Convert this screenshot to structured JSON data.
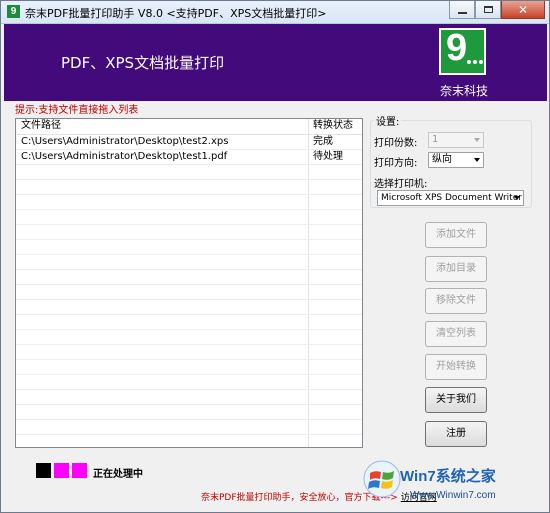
{
  "window": {
    "title": "奈末PDF批量打印助手 V8.0   <支持PDF、XPS文档批量打印>",
    "icon_glyph": "9"
  },
  "banner": {
    "title": "PDF、XPS文档批量打印",
    "brand_name": "奈末科技",
    "logo_glyph": "9"
  },
  "hint": "提示:支持文件直接拖入列表",
  "file_list": {
    "columns": [
      "文件路径",
      "转换状态"
    ],
    "rows": [
      {
        "path": "C:\\Users\\Administrator\\Desktop\\test2.xps",
        "status": "完成"
      },
      {
        "path": "C:\\Users\\Administrator\\Desktop\\test1.pdf",
        "status": "待处理"
      }
    ]
  },
  "settings": {
    "legend": "设置:",
    "copies_label": "打印份数:",
    "copies_value": "1",
    "orientation_label": "打印方向:",
    "orientation_value": "纵向",
    "printer_label": "选择打印机:",
    "printer_value": "Microsoft XPS Document Writer"
  },
  "buttons": {
    "add_file": "添加文件",
    "add_dir": "添加目录",
    "remove_file": "移除文件",
    "clear_list": "清空列表",
    "start": "开始转换",
    "about": "关于我们",
    "register": "注册"
  },
  "status_legend": {
    "colors": [
      "#000000",
      "#ff00ff",
      "#ff00ff"
    ],
    "text": "正在处理中"
  },
  "footer": "奈末PDF批量打印助手，安全放心，官方下载--->",
  "footer_link": "访问官网",
  "watermark": {
    "text": "Win7系统之家",
    "url": "Www.Winwin7.com"
  },
  "colors": {
    "banner_bg": "#430a7b",
    "logo_green": "#1e9a3c",
    "hint_red": "#c00000"
  }
}
